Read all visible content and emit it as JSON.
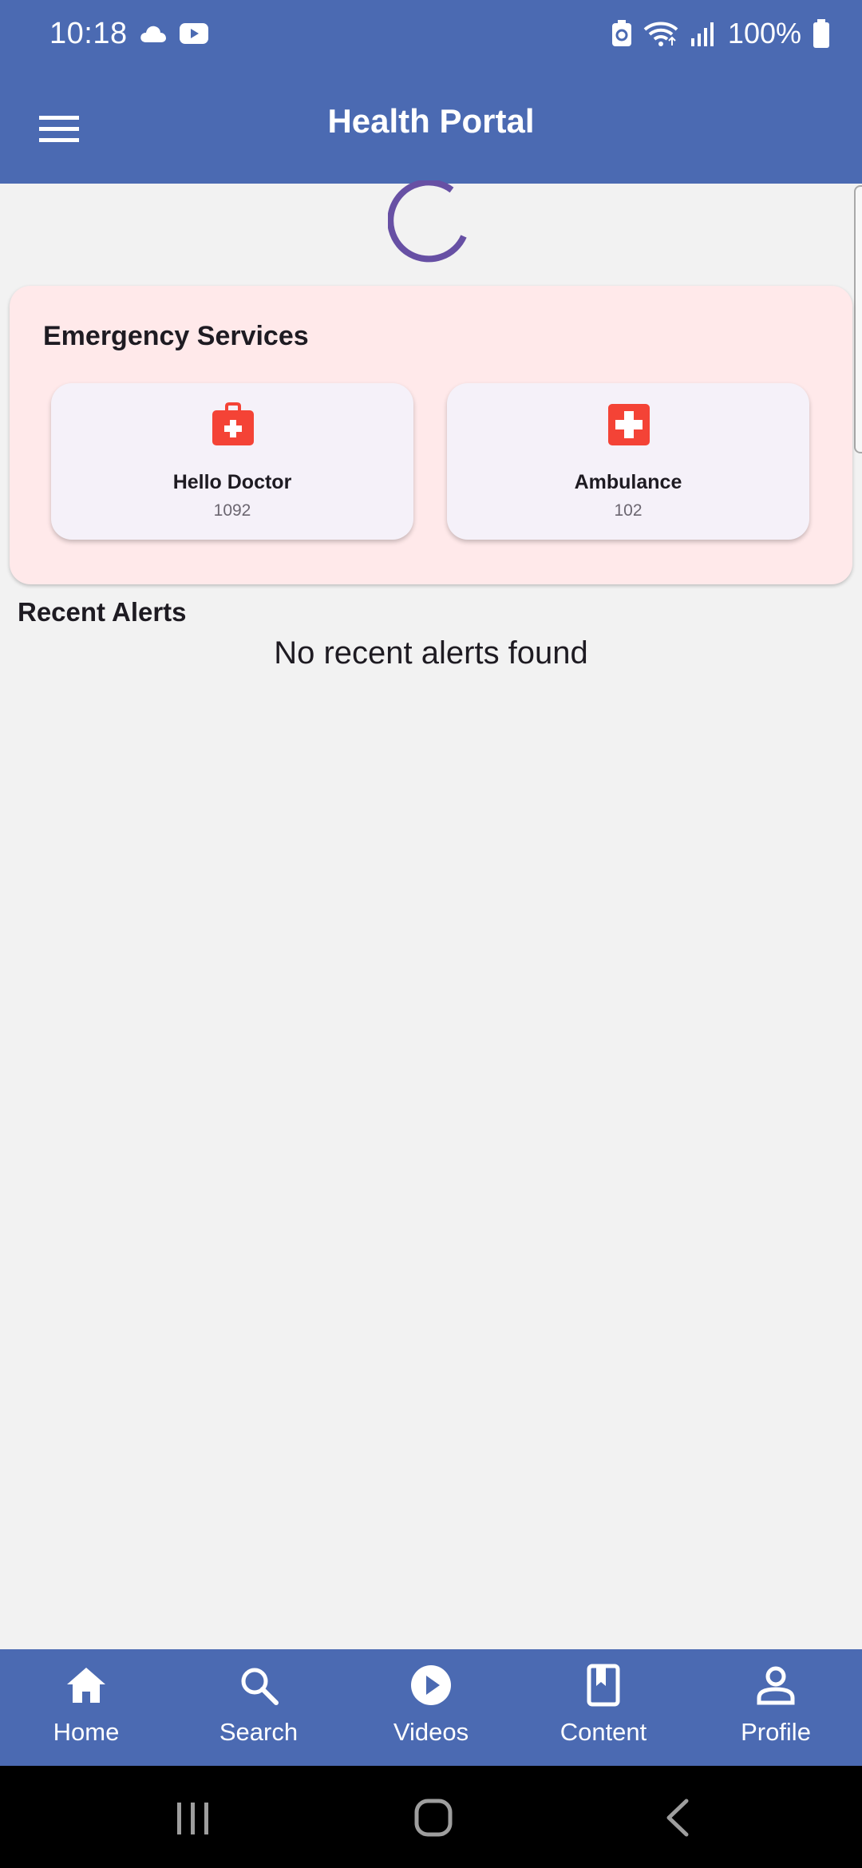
{
  "status_bar": {
    "time": "10:18",
    "battery_percent": "100%",
    "icons": [
      "cloud-icon",
      "youtube-icon",
      "battery-saver-icon",
      "wifi-icon",
      "signal-icon",
      "battery-icon"
    ]
  },
  "app_bar": {
    "title": "Health Portal",
    "menu_icon": "hamburger-menu-icon"
  },
  "emergency": {
    "title": "Emergency Services",
    "services": [
      {
        "name": "Hello Doctor",
        "number": "1092",
        "icon": "medical-bag-icon"
      },
      {
        "name": "Ambulance",
        "number": "102",
        "icon": "medical-cross-icon"
      }
    ]
  },
  "alerts": {
    "heading": "Recent Alerts",
    "empty_message": "No recent alerts found"
  },
  "bottom_nav": {
    "items": [
      {
        "label": "Home",
        "icon": "home-icon"
      },
      {
        "label": "Search",
        "icon": "search-icon"
      },
      {
        "label": "Videos",
        "icon": "play-circle-icon"
      },
      {
        "label": "Content",
        "icon": "book-icon"
      },
      {
        "label": "Profile",
        "icon": "person-icon"
      }
    ]
  },
  "colors": {
    "primary": "#4b6ab2",
    "emergency_bg": "#ffe9ea",
    "service_card_bg": "#f5f1f9",
    "service_icon": "#f44336",
    "spinner": "#6750a4",
    "page_bg": "#f2f2f2"
  }
}
